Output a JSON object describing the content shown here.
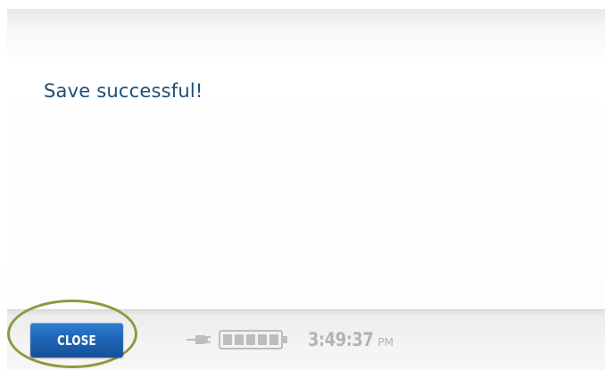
{
  "dialog": {
    "message": "Save successful!"
  },
  "bottom_bar": {
    "close_label": "CLOSE",
    "status": {
      "power_icon": "plug-icon",
      "battery_icon": "battery-icon",
      "battery_level": 1.0,
      "time": "3:49:37",
      "ampm": "PM"
    }
  },
  "colors": {
    "message_text": "#1e4f78",
    "close_button": "#1f64b6",
    "highlight_ring": "#8c9a3e",
    "status_gray": "#b8b8b8"
  }
}
